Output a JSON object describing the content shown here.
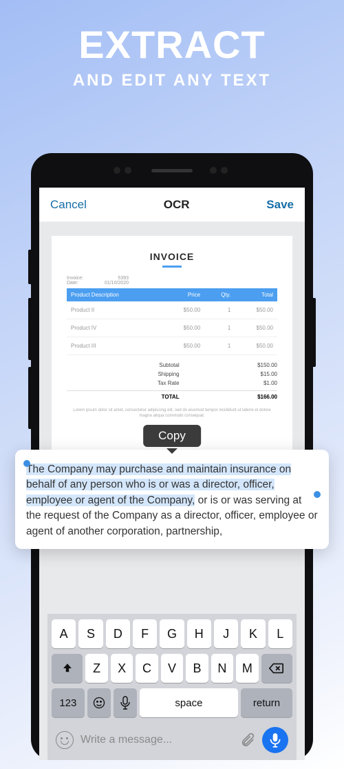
{
  "hero": {
    "title": "EXTRACT",
    "subtitle": "AND EDIT ANY TEXT"
  },
  "navbar": {
    "cancel": "Cancel",
    "title": "OCR",
    "save": "Save"
  },
  "invoice": {
    "title": "INVOICE",
    "meta_invoice_label": "Invoice:",
    "meta_invoice_val": "5393",
    "meta_date_label": "Date:",
    "meta_date_val": "01/10/2020",
    "headers": {
      "desc": "Product Description",
      "price": "Price",
      "qty": "Qty.",
      "total": "Total"
    },
    "rows": [
      {
        "desc": "Product II",
        "price": "$50.00",
        "qty": "1",
        "total": "$50.00"
      },
      {
        "desc": "Product IV",
        "price": "$50.00",
        "qty": "1",
        "total": "$50.00"
      },
      {
        "desc": "Product III",
        "price": "$50.00",
        "qty": "1",
        "total": "$50.00"
      }
    ],
    "subtotal_label": "Subtotal",
    "subtotal": "$150.00",
    "shipping_label": "Shipping",
    "shipping": "$15.00",
    "tax_label": "Tax Rate",
    "tax": "$1.00",
    "total_label": "TOTAL",
    "total": "$166.00",
    "lorem": "Lorem ipsum dolor sit amet, consectetur adipiscing elit, sed do eiusmod tempor incididunt ut labore et dolore magna aliqua commodo consequat."
  },
  "tooltip": {
    "copy": "Copy"
  },
  "selected_text": {
    "hl1": "The Company may purchase and maintain insurance on",
    "hl2": "behalf of any person who is or was a director, officer,",
    "hl3": "employee or agent of the Company,",
    "rest": " or is or was serving at the request of the Company as a director, officer, employee or agent of another corporation, partnership,"
  },
  "keyboard": {
    "row1": [
      "A",
      "S",
      "D",
      "F",
      "G",
      "H",
      "J",
      "K",
      "L"
    ],
    "row2": [
      "Z",
      "X",
      "C",
      "V",
      "B",
      "N",
      "M"
    ],
    "num": "123",
    "space": "space",
    "return": "return"
  },
  "message": {
    "placeholder": "Write a message..."
  }
}
